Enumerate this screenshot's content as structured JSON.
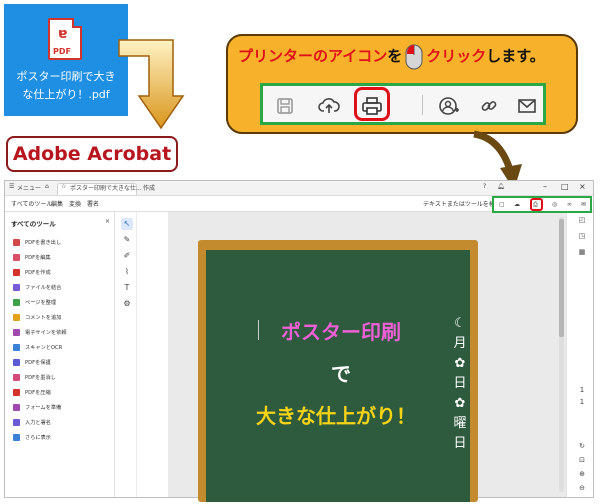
{
  "file": {
    "icon_label": "PDF",
    "name_line1": "ポスター印刷で大き",
    "name_line2": "な仕上がり！.pdf"
  },
  "app_label": "Adobe Acrobat",
  "callout": {
    "part1": "プリンターのアイコン",
    "part2": "を",
    "part3": "クリック",
    "part4": "します。",
    "toolbar_icons": [
      "save-icon",
      "upload-icon",
      "print-icon",
      "add-user-icon",
      "link-icon",
      "mail-icon"
    ]
  },
  "window": {
    "menu_label": "メニュー",
    "tab_title": "ポスター印刷で大きな仕...",
    "new_tab": "作成",
    "search_placeholder": "テキストまたはツールを検索"
  },
  "menubar": {
    "items": [
      "すべてのツール",
      "編集",
      "変換",
      "署名"
    ]
  },
  "tools": {
    "title": "すべてのツール",
    "items": [
      {
        "label": "PDFを書き出し",
        "color": "#d14a4a"
      },
      {
        "label": "PDFを編集",
        "color": "#d8506a"
      },
      {
        "label": "PDFを作成",
        "color": "#d2332a"
      },
      {
        "label": "ファイルを結合",
        "color": "#7a5bd6"
      },
      {
        "label": "ページを整理",
        "color": "#3fa04a"
      },
      {
        "label": "コメントを追加",
        "color": "#e4a21b"
      },
      {
        "label": "電子サインを依頼",
        "color": "#a04ab0"
      },
      {
        "label": "スキャンとOCR",
        "color": "#3b82d6"
      },
      {
        "label": "PDFを保護",
        "color": "#5a5ad6"
      },
      {
        "label": "PDFを墨消し",
        "color": "#d64a7a"
      },
      {
        "label": "PDFを圧縮",
        "color": "#d2332a"
      },
      {
        "label": "フォームを準備",
        "color": "#a04ab0"
      },
      {
        "label": "入力と署名",
        "color": "#6a5ad6"
      },
      {
        "label": "さらに表示",
        "color": "#3b82d6"
      }
    ]
  },
  "poster": {
    "line1": "ポスター印刷",
    "line2": "で",
    "line3": "大きな仕上がり！",
    "vertical": [
      "月",
      "日",
      "曜",
      "日"
    ]
  },
  "colors": {
    "accent_orange": "#f7b12a",
    "highlight_green": "#2aa846",
    "highlight_red": "#e0101b",
    "file_tile_blue": "#1f8fe3",
    "board_green": "#2e5a3e"
  }
}
